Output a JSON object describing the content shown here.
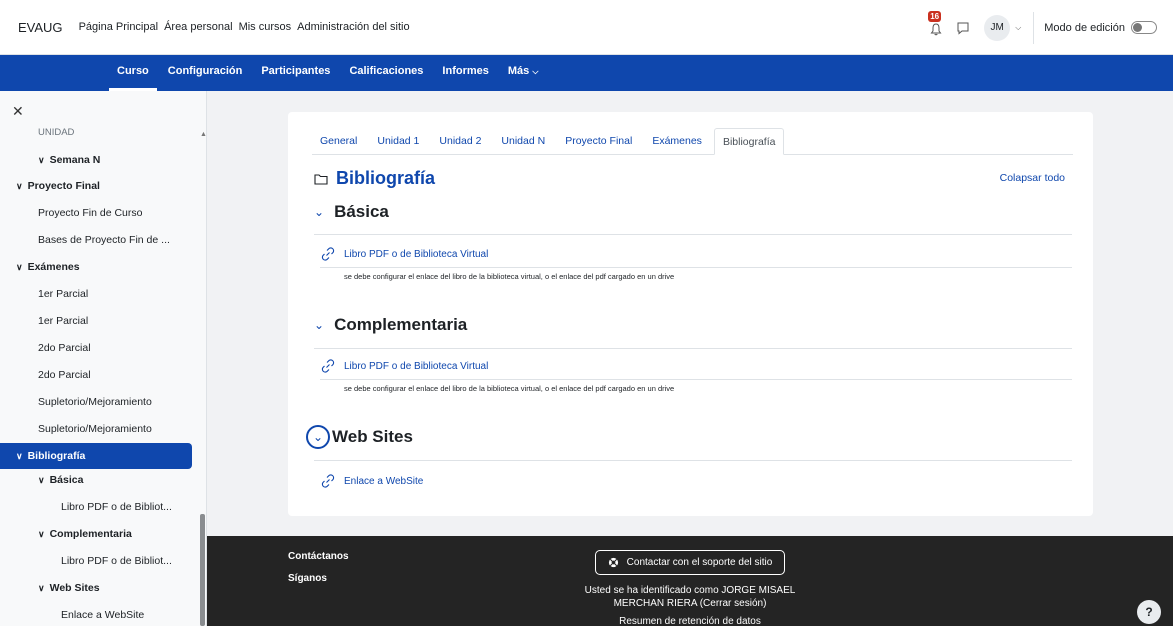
{
  "topbar": {
    "brand": "EVAUG",
    "links": [
      "Página Principal",
      "Área personal",
      "Mis cursos",
      "Administración del sitio"
    ],
    "notification_count": "16",
    "avatar_initials": "JM",
    "edit_mode_label": "Modo de edición",
    "edit_mode_on": false
  },
  "secnav": {
    "items": [
      "Curso",
      "Configuración",
      "Participantes",
      "Calificaciones",
      "Informes",
      "Más"
    ],
    "active": "Curso"
  },
  "drawer": {
    "items": [
      {
        "label": "UNIDAD",
        "level": 1,
        "bold": false
      },
      {
        "label": "Semana N",
        "level": 1,
        "bold": true,
        "chevron": true
      },
      {
        "label": "Proyecto Final",
        "level": 0,
        "bold": true,
        "chevron": true
      },
      {
        "label": "Proyecto Fin de Curso",
        "level": 1,
        "bold": false
      },
      {
        "label": "Bases de Proyecto Fin de ...",
        "level": 1,
        "bold": false
      },
      {
        "label": "Exámenes",
        "level": 0,
        "bold": true,
        "chevron": true
      },
      {
        "label": "1er Parcial",
        "level": 1,
        "bold": false
      },
      {
        "label": "1er Parcial",
        "level": 1,
        "bold": false
      },
      {
        "label": "2do Parcial",
        "level": 1,
        "bold": false
      },
      {
        "label": "2do Parcial",
        "level": 1,
        "bold": false
      },
      {
        "label": "Supletorio/Mejoramiento",
        "level": 1,
        "bold": false
      },
      {
        "label": "Supletorio/Mejoramiento",
        "level": 1,
        "bold": false
      },
      {
        "label": "Bibliografía",
        "level": 0,
        "bold": true,
        "chevron": true,
        "active": true
      },
      {
        "label": "Básica",
        "level": 1,
        "bold": true,
        "chevron": true
      },
      {
        "label": "Libro PDF o de Bibliot...",
        "level": 2,
        "bold": false
      },
      {
        "label": "Complementaria",
        "level": 1,
        "bold": true,
        "chevron": true
      },
      {
        "label": "Libro PDF o de Bibliot...",
        "level": 2,
        "bold": false
      },
      {
        "label": "Web Sites",
        "level": 1,
        "bold": true,
        "chevron": true
      },
      {
        "label": "Enlace a WebSite",
        "level": 2,
        "bold": false
      }
    ]
  },
  "main": {
    "tabs": [
      "General",
      "Unidad 1",
      "Unidad 2",
      "Unidad N",
      "Proyecto Final",
      "Exámenes",
      "Bibliografía"
    ],
    "active_tab": "Bibliografía",
    "title": "Bibliografía",
    "collapse_all": "Colapsar todo",
    "sections": [
      {
        "title": "Básica",
        "activity": "Libro PDF o de Biblioteca Virtual",
        "desc": "se debe configurar el enlace del libro de la biblioteca virtual, o el enlace del pdf cargado en un drive"
      },
      {
        "title": "Complementaria",
        "activity": "Libro PDF o de Biblioteca Virtual",
        "desc": "se debe configurar el enlace del libro de la biblioteca virtual, o el enlace del pdf cargado en un drive"
      },
      {
        "title": "Web Sites",
        "activity": "Enlace a WebSite",
        "desc": ""
      }
    ]
  },
  "footer": {
    "contact": "Contáctanos",
    "follow": "Síganos",
    "support_button": "Contactar con el soporte del sitio",
    "logged_in": "Usted se ha identificado como JORGE MISAEL MERCHAN RIERA (Cerrar sesión)",
    "retention": "Resumen de retención de datos",
    "help": "?"
  },
  "colors": {
    "primary": "#0f47ad",
    "footer": "#242424",
    "badge": "#ca3120"
  }
}
